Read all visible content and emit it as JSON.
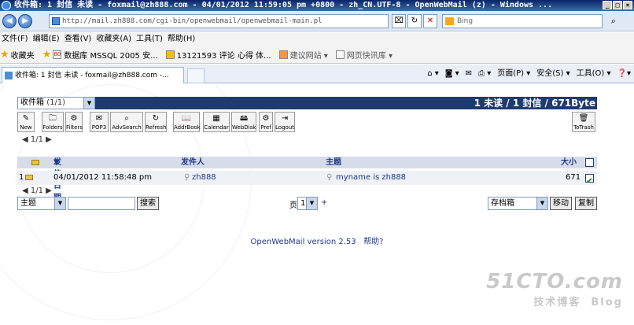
{
  "window": {
    "title": "收件箱: 1 封信 未读 - foxmail@zh888.com - 04/01/2012 11:59:05 pm +0800 - zh_CN.UTF-8 - OpenWebMail (z) - Windows ..."
  },
  "address_bar": {
    "url": "http://mail.zh888.com/cgi-bin/openwebmail/openwebmail-main.pl",
    "search_placeholder": "Bing"
  },
  "menu": [
    "文件(F)",
    "编辑(E)",
    "查看(V)",
    "收藏夹(A)",
    "工具(T)",
    "帮助(H)"
  ],
  "favorites": {
    "label": "收藏夹",
    "items": [
      "数据库 MSSQL 2005 安...",
      "13121593 评论 心得 体...",
      "建议网站 ▾",
      "网页快讯库 ▾"
    ]
  },
  "tab": {
    "title": "收件箱: 1 封信 未读 - foxmail@zh888.com -..."
  },
  "commands": [
    "页面(P) ▾",
    "安全(S) ▾",
    "工具(O) ▾"
  ],
  "mail": {
    "folder_name": "收件箱",
    "folder_count": "(1/1)",
    "summary": "1 未读  / 1 封信  / 671Byte",
    "toolbar": [
      "New",
      "Folders",
      "Filters",
      "POP3",
      "AdvSearch",
      "Refresh",
      "AddrBook",
      "Calendar",
      "WebDisk",
      "Pref",
      "Logout"
    ],
    "to_trash": "ToTrash",
    "pager": "1/1",
    "columns": {
      "date": "发信日期",
      "from": "发件人",
      "subject": "主题",
      "size": "大小"
    },
    "rows": [
      {
        "num": "1",
        "date": "04/01/2012 11:58:48 pm",
        "from": "zh888",
        "subject": "myname is zh888",
        "size": "671"
      }
    ],
    "search_field": "主题",
    "search_button": "搜索",
    "page_label": "页",
    "page_value": "1",
    "page_plus": "+",
    "move_target": "存档箱",
    "move_button": "移动",
    "copy_button": "复制"
  },
  "footer": {
    "version": "OpenWebMail version 2.53",
    "help": "帮助?"
  },
  "watermark": {
    "line1": "51CTO.com",
    "line2": "技术博客",
    "line3": "Blog"
  },
  "colors": {
    "header_bar": "#1f3a6e",
    "column_header": "#d6dcea",
    "link": "#1f3a8a"
  }
}
